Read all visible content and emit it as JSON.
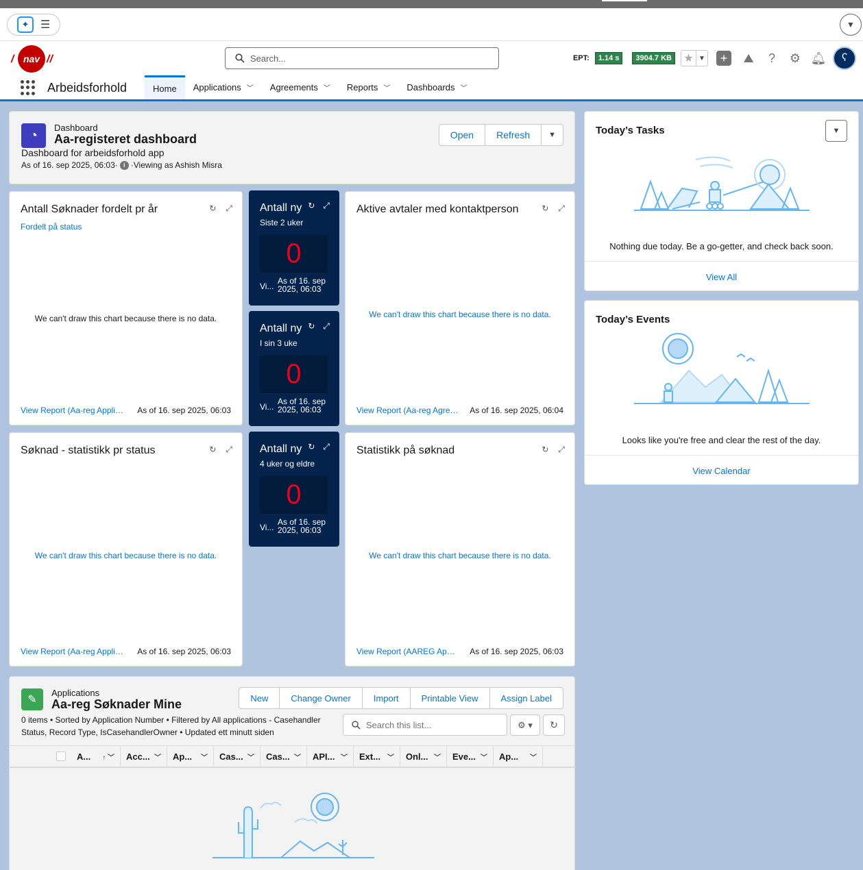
{
  "header": {
    "logo_text": "nav",
    "search_placeholder": "Search...",
    "ept_label": "EPT:",
    "ept_value": "1.14 s",
    "ept_size": "3904.7 KB"
  },
  "app": {
    "name": "Arbeidsforhold",
    "tabs": [
      {
        "label": "Home",
        "active": true
      },
      {
        "label": "Applications",
        "active": false
      },
      {
        "label": "Agreements",
        "active": false
      },
      {
        "label": "Reports",
        "active": false
      },
      {
        "label": "Dashboards",
        "active": false
      }
    ]
  },
  "dashboard": {
    "type_label": "Dashboard",
    "title": "Aa-registeret dashboard",
    "description": "Dashboard for arbeidsforhold app",
    "as_of": "As of 16. sep 2025, 06:03·",
    "viewing_as": "·Viewing as Ashish Misra",
    "open_label": "Open",
    "refresh_label": "Refresh"
  },
  "widgets": {
    "w1": {
      "title": "Antall Søknader fordelt pr år",
      "subtitle": "Fordelt på status",
      "nodata": "We can't draw this chart because there is no data.",
      "link": "View Report (Aa-reg Applications)",
      "asof": "As of 16. sep 2025, 06:03"
    },
    "w2": {
      "title": "Aktive avtaler med kontaktperson",
      "nodata": "We can't draw this chart because there is no data.",
      "link": "View Report (Aa-reg Agreements)",
      "asof": "As of 16. sep 2025, 06:04"
    },
    "w3": {
      "title": "Søknad - statistikk pr status",
      "nodata": "We can't draw this chart because there is no data.",
      "link": "View Report (Aa-reg Applications)",
      "asof": "As of 16. sep 2025, 06:03"
    },
    "w4": {
      "title": "Statistikk på søknad",
      "nodata": "We can't draw this chart because there is no data.",
      "link": "View Report (AAREG Applications)",
      "asof": "As of 16. sep 2025, 06:03"
    }
  },
  "metrics": [
    {
      "title": "Antall ny",
      "subtitle": "Siste 2 uker",
      "value": "0",
      "vi": "Vi...",
      "asof_line1": "As of 16. sep",
      "asof_line2": "2025, 06:03"
    },
    {
      "title": "Antall ny",
      "subtitle": "I sin 3 uke",
      "value": "0",
      "vi": "Vi...",
      "asof_line1": "As of 16. sep",
      "asof_line2": "2025, 06:03"
    },
    {
      "title": "Antall ny",
      "subtitle": "4 uker og eldre",
      "value": "0",
      "vi": "Vi...",
      "asof_line1": "As of 16. sep",
      "asof_line2": "2025, 06:03"
    }
  ],
  "tasks": {
    "title": "Today’s Tasks",
    "message": "Nothing due today. Be a go-getter, and check back soon.",
    "link": "View All"
  },
  "events": {
    "title": "Today’s Events",
    "message": "Looks like you're free and clear the rest of the day.",
    "link": "View Calendar"
  },
  "applications": {
    "type_label": "Applications",
    "title": "Aa-reg Søknader Mine",
    "meta_line1": "0 items • Sorted by Application Number • Filtered by All applications - Casehandler",
    "meta_line2": "Status, Record Type, IsCasehandlerOwner • Updated ett minutt siden",
    "buttons": [
      "New",
      "Change Owner",
      "Import",
      "Printable View",
      "Assign Label"
    ],
    "search_placeholder": "Search this list...",
    "columns": [
      "A...",
      "Acc...",
      "Ap...",
      "Cas...",
      "Cas...",
      "API...",
      "Ext...",
      "Onl...",
      "Eve...",
      "Ap..."
    ]
  }
}
